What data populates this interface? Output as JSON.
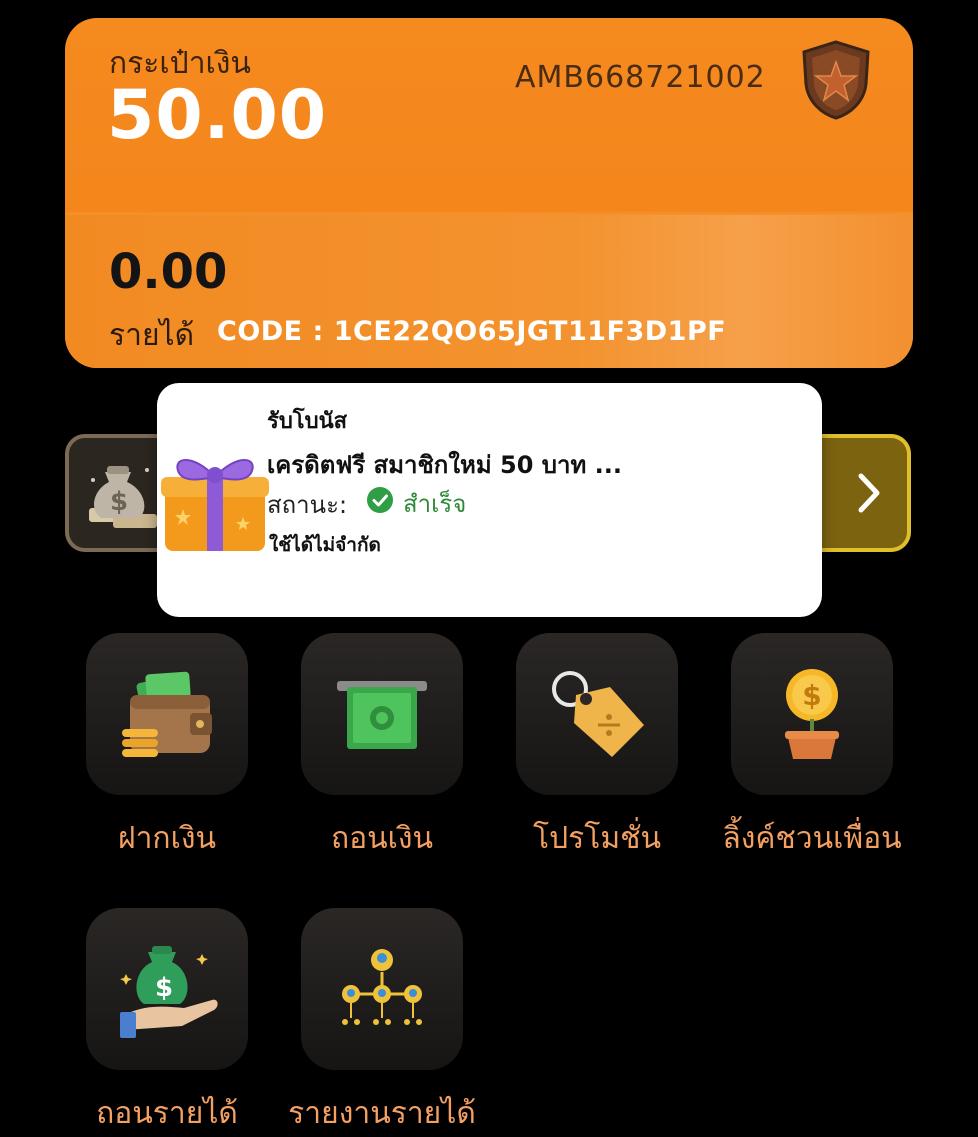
{
  "wallet": {
    "label": "กระเป๋าเงิน",
    "balance": "50.00",
    "account_id": "AMB668721002",
    "income_amount": "0.00",
    "income_label": "รายได้",
    "code": "CODE : 1CE22QO65JGT11F3D1PF",
    "badge_icon": "star-shield-icon"
  },
  "popup": {
    "title": "รับโบนัส",
    "bonus_name": "เครดิตฟรี สมาชิกใหม่ 50 บาท ...",
    "status_label": "สถานะ:",
    "status_value": "สำเร็จ",
    "usage_note": "ใช้ได้ไม่จำกัด",
    "status_color": "#2f9e44"
  },
  "menu": [
    {
      "label": "ฝากเงิน",
      "icon": "wallet-icon"
    },
    {
      "label": "ถอนเงิน",
      "icon": "cash-withdraw-icon"
    },
    {
      "label": "โปรโมชั่น",
      "icon": "price-tag-icon"
    },
    {
      "label": "ลิ้งค์ชวนเพื่อน",
      "icon": "coin-plant-icon"
    },
    {
      "label": "ถอนรายได้",
      "icon": "money-bag-hand-icon"
    },
    {
      "label": "รายงานรายได้",
      "icon": "referral-tree-icon"
    }
  ],
  "colors": {
    "accent": "#f58a1f",
    "label": "#f3a061",
    "background": "#000000"
  }
}
